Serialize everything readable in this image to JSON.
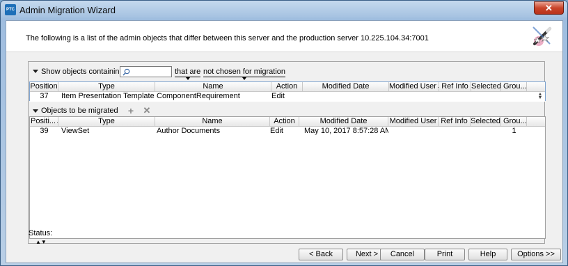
{
  "window": {
    "title": "Admin Migration Wizard",
    "app_icon_text": "PTC",
    "close_glyph": "✕"
  },
  "header": {
    "description": "The following is a list of the admin objects that differ between this server and the production server 10.225.104.34:7001",
    "wizard_icon": "wizard-wand-icon"
  },
  "filter": {
    "label": "Show objects containing",
    "search_value": "",
    "condition_dropdown": "that are",
    "state_dropdown": "not chosen for migration"
  },
  "available_table": {
    "columns": [
      "Position",
      "Type",
      "Name",
      "Action",
      "Modified Date",
      "Modified User",
      "Ref Info",
      "Selected",
      "Grou..."
    ],
    "rows": [
      {
        "position": "37",
        "type": "Item Presentation Template",
        "name": "ComponentRequirement",
        "action": "Edit",
        "modified_date": "",
        "modified_user": "",
        "ref_info": "",
        "selected": "",
        "group": ""
      }
    ]
  },
  "migrate_section": {
    "label": "Objects to be migrated",
    "add_icon": "plus-icon",
    "remove_icon": "x-icon"
  },
  "migrate_table": {
    "columns": [
      "Positi...",
      "Type",
      "Name",
      "Action",
      "Modified Date",
      "Modified User",
      "Ref Info",
      "Selected",
      "Grou..."
    ],
    "rows": [
      {
        "position": "39",
        "type": "ViewSet",
        "name": "Author Documents",
        "action": "Edit",
        "modified_date": "May 10, 2017 8:57:28 AM",
        "modified_user": "",
        "ref_info": "",
        "selected": "",
        "group": "1"
      }
    ]
  },
  "status": {
    "label": "Status:"
  },
  "buttons": {
    "back": "< Back",
    "next": "Next >",
    "cancel": "Cancel",
    "print": "Print",
    "help": "Help",
    "options": "Options >>"
  },
  "colors": {
    "title_bar": "#b9cfe6",
    "close_button": "#c9442a",
    "selection_border": "#7da2ce"
  }
}
